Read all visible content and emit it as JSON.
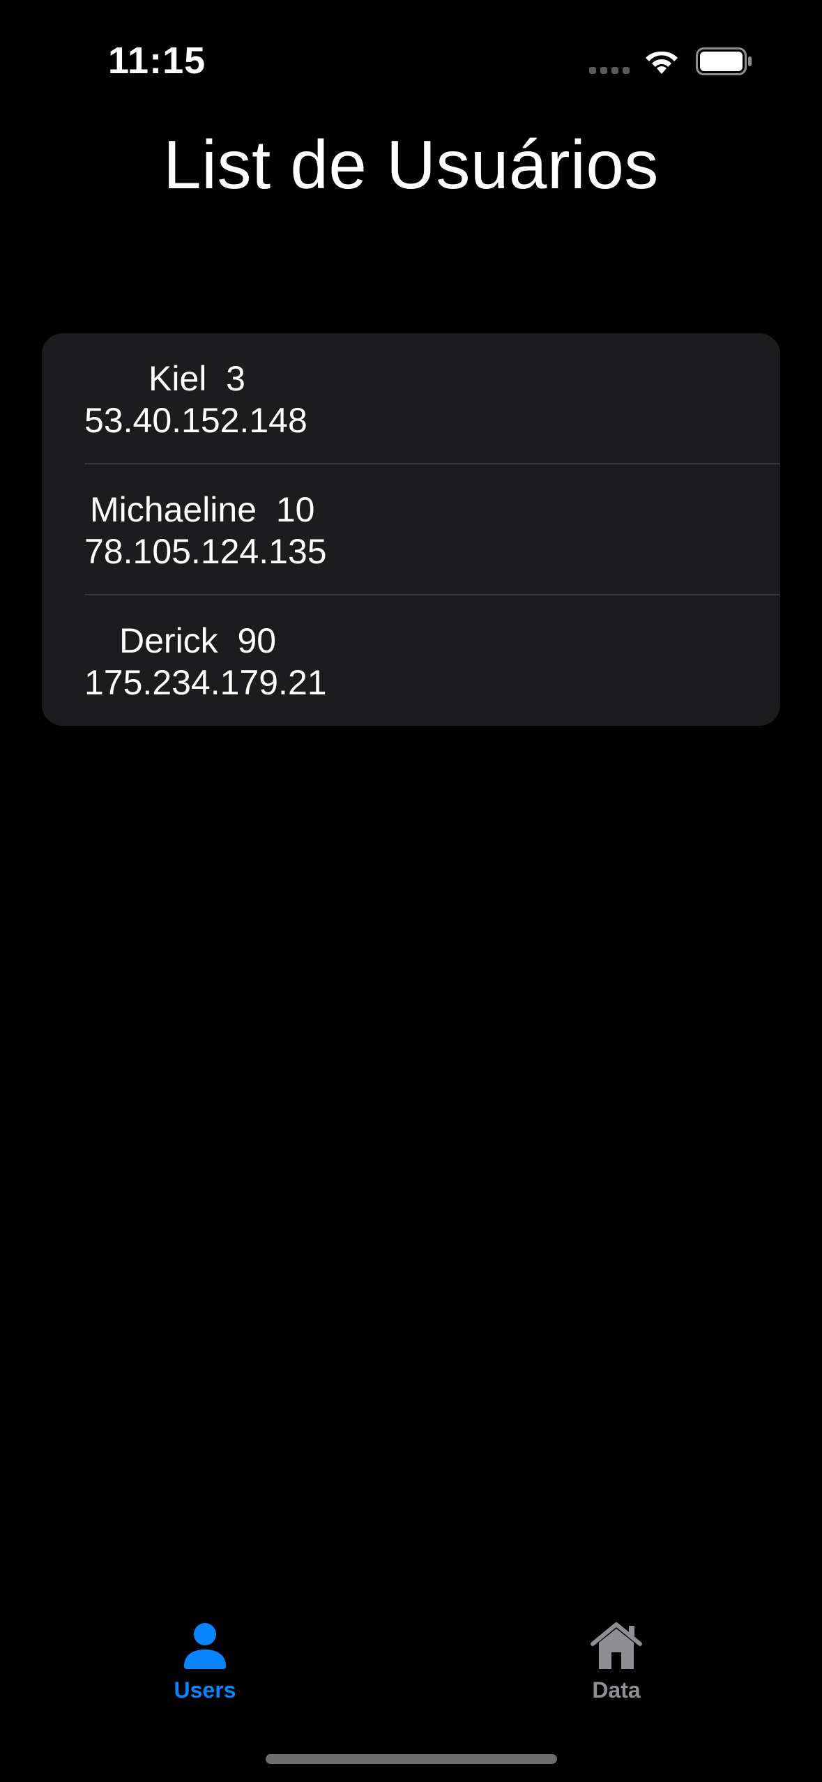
{
  "status_bar": {
    "time": "11:15"
  },
  "title": "List de Usuários",
  "users": [
    {
      "name": "Kiel",
      "number": "3",
      "ip": "53.40.152.148"
    },
    {
      "name": "Michaeline",
      "number": "10",
      "ip": "78.105.124.135"
    },
    {
      "name": "Derick",
      "number": "90",
      "ip": "175.234.179.21"
    }
  ],
  "tab_bar": {
    "tabs": [
      {
        "label": "Users",
        "icon": "person-icon",
        "active": true
      },
      {
        "label": "Data",
        "icon": "house-icon",
        "active": false
      }
    ]
  },
  "colors": {
    "background": "#000000",
    "card": "#1c1c1e",
    "accent": "#0a84ff",
    "inactive": "#8e8e93"
  }
}
